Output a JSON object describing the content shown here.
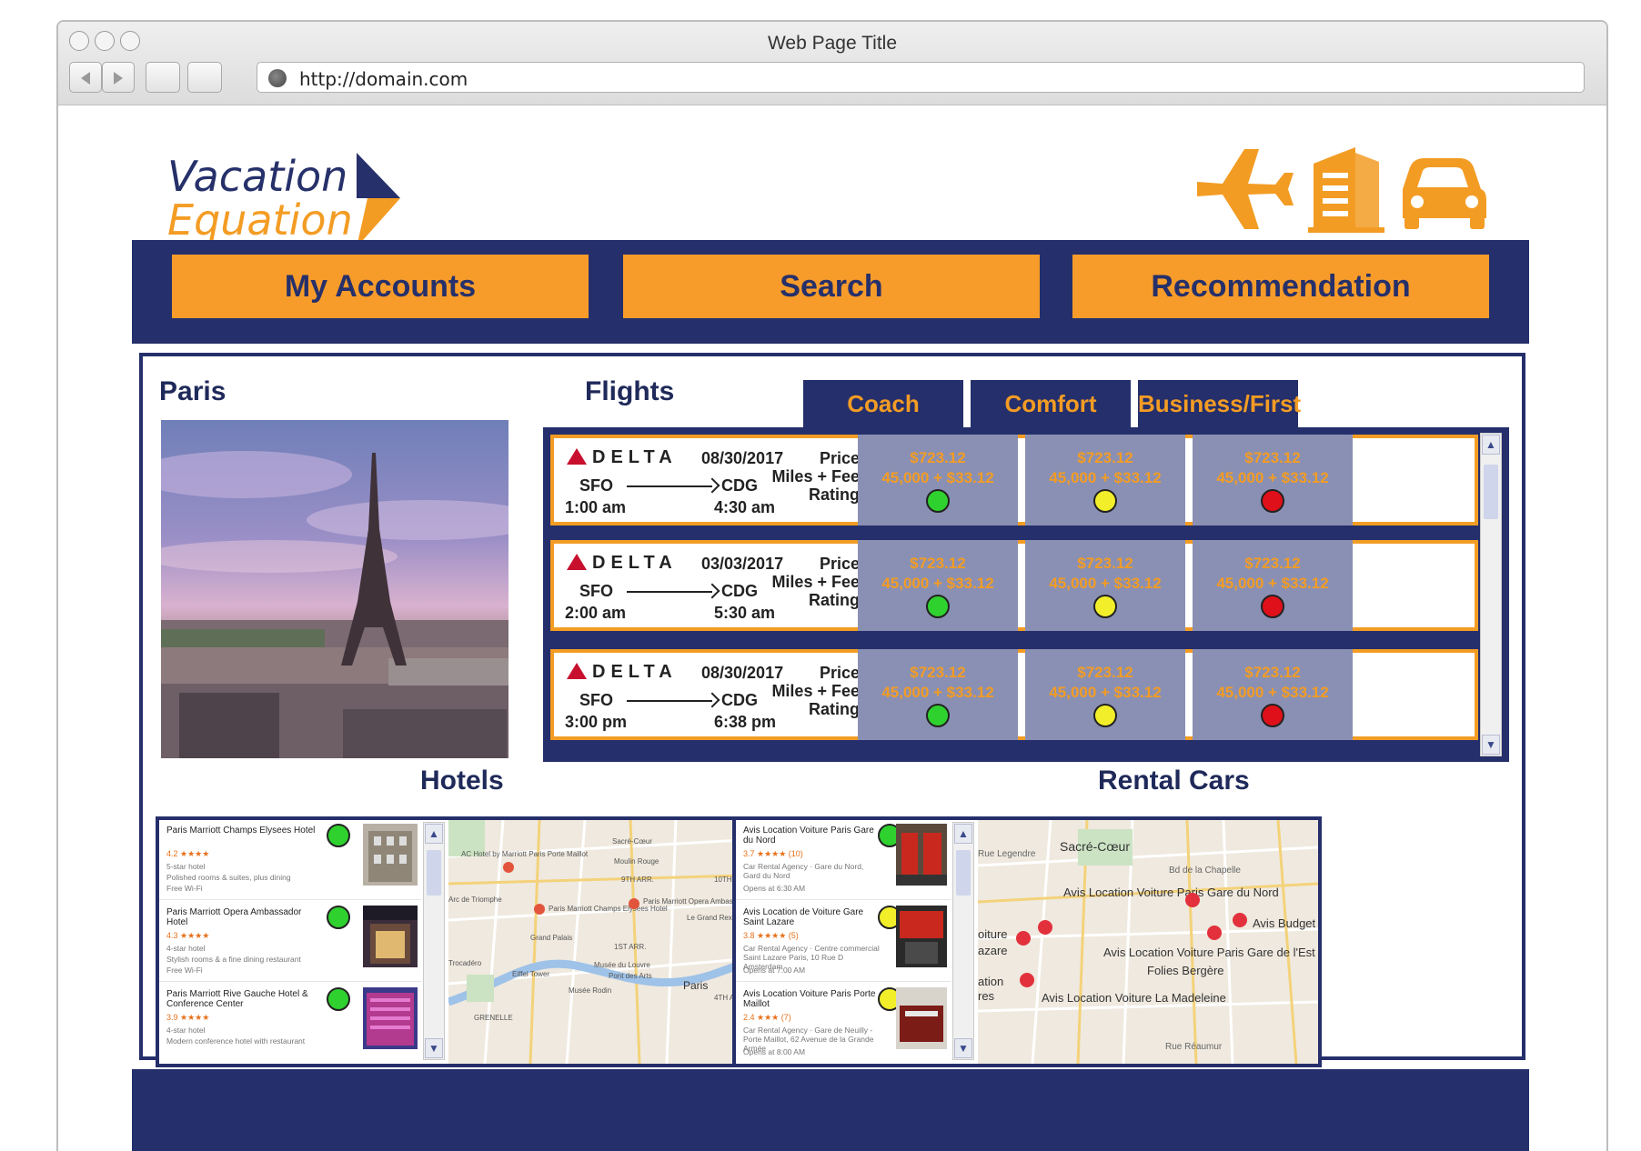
{
  "window": {
    "title": "Web Page Title",
    "url": "http://domain.com"
  },
  "logo": {
    "line1": "Vacation",
    "line2": "Equation"
  },
  "top_icons": [
    "airplane-icon",
    "hotel-building-icon",
    "car-icon"
  ],
  "nav": {
    "accounts": "My Accounts",
    "search": "Search",
    "recommendation": "Recommendation"
  },
  "destination": {
    "title": "Paris"
  },
  "flights": {
    "title": "Flights",
    "classes": [
      "Coach",
      "Comfort",
      "Business/First"
    ],
    "labels": {
      "price": "Price",
      "miles": "Miles + Fee",
      "rating": "Rating"
    },
    "rows": [
      {
        "airline": "DELTA",
        "date": "08/30/2017",
        "from": "SFO",
        "to": "CDG",
        "depart": "1:00 am",
        "arrive": "4:30 am",
        "fares": [
          {
            "price": "$723.12",
            "miles": "45,000 + $33.12",
            "rating": "green"
          },
          {
            "price": "$723.12",
            "miles": "45,000 + $33.12",
            "rating": "yellow"
          },
          {
            "price": "$723.12",
            "miles": "45,000 + $33.12",
            "rating": "red"
          }
        ]
      },
      {
        "airline": "DELTA",
        "date": "03/03/2017",
        "from": "SFO",
        "to": "CDG",
        "depart": "2:00 am",
        "arrive": "5:30 am",
        "fares": [
          {
            "price": "$723.12",
            "miles": "45,000 + $33.12",
            "rating": "green"
          },
          {
            "price": "$723.12",
            "miles": "45,000 + $33.12",
            "rating": "yellow"
          },
          {
            "price": "$723.12",
            "miles": "45,000 + $33.12",
            "rating": "red"
          }
        ]
      },
      {
        "airline": "DELTA",
        "date": "08/30/2017",
        "from": "SFO",
        "to": "CDG",
        "depart": "3:00 pm",
        "arrive": "6:38 pm",
        "fares": [
          {
            "price": "$723.12",
            "miles": "45,000 + $33.12",
            "rating": "green"
          },
          {
            "price": "$723.12",
            "miles": "45,000 + $33.12",
            "rating": "yellow"
          },
          {
            "price": "$723.12",
            "miles": "45,000 + $33.12",
            "rating": "red"
          }
        ]
      }
    ]
  },
  "hotels": {
    "title": "Hotels",
    "items": [
      {
        "name": "Paris Marriott Champs Elysees Hotel",
        "rating": "4.2 ★★★★",
        "d1": "5-star hotel",
        "d2": "Polished rooms & suites, plus dining",
        "d3": "Free Wi-Fi",
        "indicator": "green"
      },
      {
        "name": "Paris Marriott Opera Ambassador Hotel",
        "rating": "4.3 ★★★★",
        "d1": "4-star hotel",
        "d2": "Stylish rooms & a fine dining restaurant",
        "d3": "Free Wi-Fi",
        "indicator": "green"
      },
      {
        "name": "Paris Marriott Rive Gauche Hotel & Conference Center",
        "rating": "3.9 ★★★★",
        "d1": "4-star hotel",
        "d2": "Modern conference hotel with restaurant",
        "d3": "",
        "indicator": "green"
      }
    ],
    "map_labels": [
      "Sacré-Cœur",
      "Moulin Rouge",
      "9TH ARR.",
      "10TH ARR.",
      "AC Hotel by Marriott Paris Porte Maillot",
      "Paris Marriott Champs Elysees Hotel",
      "Paris Marriott Opera Ambassador Hotel",
      "Arc de Triomphe",
      "Grand Palais",
      "1ST ARR.",
      "Eiffel Tower",
      "Musée du Louvre",
      "Pont des Arts",
      "Musée Rodin",
      "Paris",
      "4TH ARR.",
      "Trocadéro",
      "GRENELLE",
      "Le Grand Rex"
    ]
  },
  "rental_cars": {
    "title": "Rental Cars",
    "items": [
      {
        "name": "Avis Location Voiture Paris Gare du Nord",
        "rating": "3.7 ★★★★ (10)",
        "d1": "Car Rental Agency · Gare du Nord, Gard du Nord",
        "d2": "Opens at 6:30 AM",
        "indicator": "green"
      },
      {
        "name": "Avis Location de Voiture Gare Saint Lazare",
        "rating": "3.8 ★★★★ (5)",
        "d1": "Car Rental Agency · Centre commercial Saint Lazare Paris, 10 Rue D Amsterdam",
        "d2": "Opens at 7:00 AM",
        "indicator": "yellow"
      },
      {
        "name": "Avis Location Voiture Paris Porte Maillot",
        "rating": "2.4 ★★★ (7)",
        "d1": "Car Rental Agency · Gare de Neuilly - Porte Maillot, 62 Avenue de la Grande Armée",
        "d2": "Opens at 8:00 AM",
        "indicator": "yellow"
      }
    ],
    "map_labels": [
      "Sacré-Cœur",
      "Bd de la Chapelle",
      "Avis Location Voiture Paris Gare du Nord",
      "Avis Location Voiture Paris Gare de l'Est",
      "Avis Budget",
      "Folies Bergère",
      "Avis Location Voiture La Madeleine",
      "oiture",
      "azare",
      "ation",
      "res",
      "Rue Réaumur",
      "Rue Legendre"
    ]
  },
  "colors": {
    "navy": "#252f6b",
    "orange": "#f79c2a",
    "fare_bg": "#8a90b3",
    "green": "#2fd12f",
    "yellow": "#f2ef2a",
    "red": "#e0101a"
  }
}
